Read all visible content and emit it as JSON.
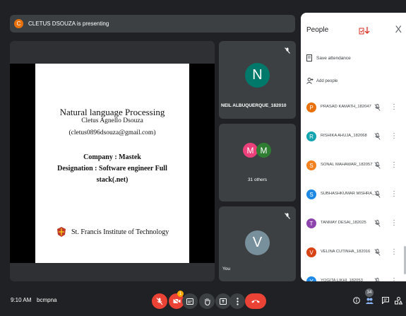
{
  "banner": {
    "avatar_letter": "C",
    "text": "CLETUS DSOUZA is presenting"
  },
  "slide": {
    "title": "Natural language Processing",
    "author": "Cletus Agnello Dsouza",
    "email": "(cletus0896dsouza@gmail.com)",
    "company": "Company : Mastek",
    "designation_line1": "Designation : Software engineer Full",
    "designation_line2": "stack(.net)",
    "institute": "St. Francis Institute of Technology"
  },
  "tiles": {
    "neil": {
      "letter": "N",
      "name": "NEIL ALBUQUERQUE_182010",
      "color": "#00796b"
    },
    "others": {
      "letters": [
        "M",
        "M"
      ],
      "label": "31 others",
      "colors": [
        "#ec407a",
        "#2e7d32"
      ]
    },
    "you": {
      "letter": "V",
      "name": "You",
      "color": "#78909c"
    }
  },
  "panel": {
    "title": "People",
    "save_attendance": "Save attendance",
    "add_people": "Add people",
    "close": "X",
    "participants": [
      {
        "letter": "P",
        "name": "PRASAD KAMATH_182047",
        "color": "#e8710a"
      },
      {
        "letter": "R",
        "name": "RISHIKA AHUJA_182068",
        "color": "#12a4af"
      },
      {
        "letter": "S",
        "name": "SONAL MAHAWAR_182057",
        "color": "#f4811f"
      },
      {
        "letter": "S",
        "name": "SUBHASHKUMAR MISHRA_...",
        "color": "#1e88e5"
      },
      {
        "letter": "T",
        "name": "TANMAY DESAI_182025",
        "color": "#8e44ad"
      },
      {
        "letter": "V",
        "name": "VELINA CUTINHA_182016",
        "color": "#d84315"
      },
      {
        "letter": "Y",
        "name": "YOGITA LIKHI_182053",
        "color": "#1e88e5"
      }
    ]
  },
  "bottom": {
    "time": "9:10 AM",
    "meeting_code": "bcmpna",
    "people_count": "34",
    "notification_count": "1"
  },
  "colors": {
    "end_call": "#ea4335",
    "mic_off": "#ea4335"
  }
}
